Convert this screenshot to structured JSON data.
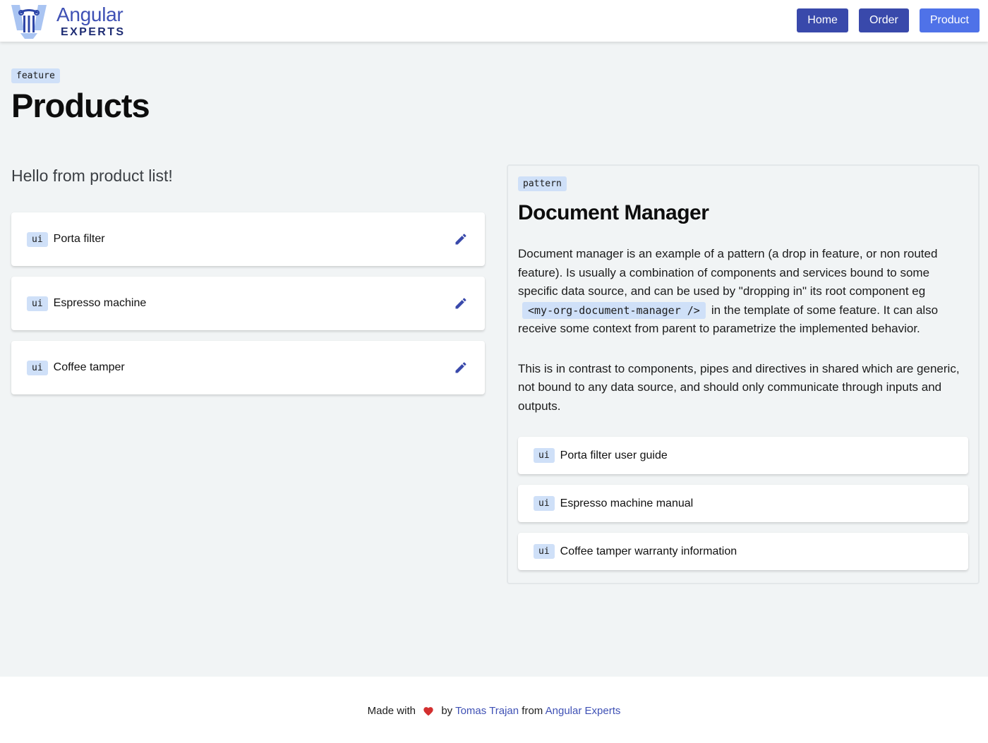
{
  "header": {
    "logo": {
      "line1": "Angular",
      "line2": "EXPERTS",
      "icon": "column-pillar-icon"
    },
    "nav": [
      {
        "label": "Home",
        "active": false
      },
      {
        "label": "Order",
        "active": false
      },
      {
        "label": "Product",
        "active": true
      }
    ]
  },
  "page": {
    "tag": "feature",
    "title": "Products"
  },
  "product_list": {
    "greeting": "Hello from product list!",
    "items": [
      {
        "tag": "ui",
        "label": "Porta filter",
        "action_icon": "pencil-edit-icon"
      },
      {
        "tag": "ui",
        "label": "Espresso machine",
        "action_icon": "pencil-edit-icon"
      },
      {
        "tag": "ui",
        "label": "Coffee tamper",
        "action_icon": "pencil-edit-icon"
      }
    ]
  },
  "document_manager": {
    "tag": "pattern",
    "title": "Document Manager",
    "paragraph1_before": "Document manager is an example of a pattern (a drop in feature, or non routed feature). Is usually a combination of components and services bound to some specific data source, and can be used by \"dropping in\" its root component eg",
    "paragraph1_code": "<my-org-document-manager />",
    "paragraph1_after": "in the template of some feature. It can also receive some context from parent to parametrize the implemented behavior.",
    "paragraph2": "This is in contrast to components, pipes and directives in shared which are generic, not bound to any data source, and should only communicate through inputs and outputs.",
    "documents": [
      {
        "tag": "ui",
        "label": "Porta filter user guide"
      },
      {
        "tag": "ui",
        "label": "Espresso machine manual"
      },
      {
        "tag": "ui",
        "label": "Coffee tamper warranty information"
      }
    ]
  },
  "footer": {
    "made_with": "Made with",
    "by": "by",
    "author": "Tomas Trajan",
    "from": "from",
    "org": "Angular Experts",
    "heart_icon": "heart-icon"
  },
  "colors": {
    "nav_button": "#3949ab",
    "nav_button_active": "#4f72e8",
    "tag_bg": "#cfe0f8",
    "link": "#3f51b5",
    "background": "#f1f4f5"
  }
}
